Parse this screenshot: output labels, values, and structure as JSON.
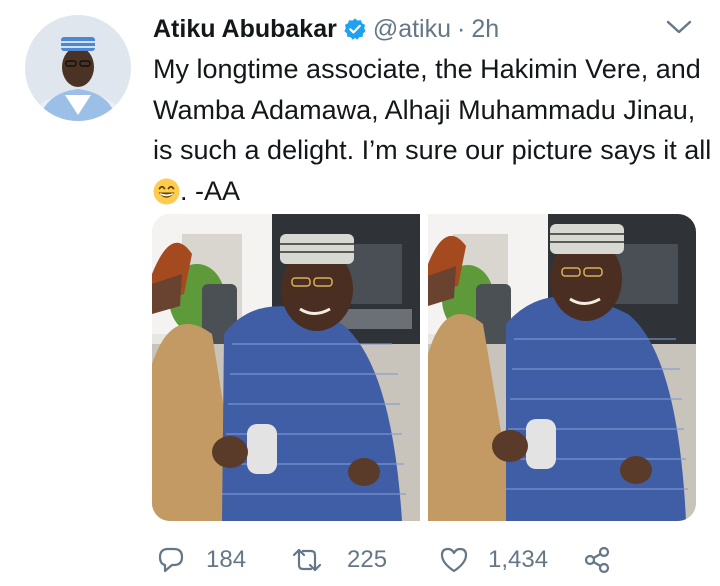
{
  "tweet": {
    "author_name": "Atiku Abubakar",
    "handle": "@atiku",
    "separator": "·",
    "time": "2h",
    "text": "My longtime associate, the Hakimin Vere, and Wamba Adamawa, Alhaji Muhammadu Jinau, is such a delight. I’m sure our picture says it all",
    "text_suffix": ". -AA",
    "emoji": "grinning-face-with-smiling-eyes"
  },
  "actions": {
    "reply_count": "184",
    "retweet_count": "225",
    "like_count": "1,434"
  },
  "icons": {
    "verified": "verified-badge-icon",
    "caret": "chevron-down-icon",
    "reply": "reply-icon",
    "retweet": "retweet-icon",
    "like": "heart-icon",
    "share": "share-icon"
  },
  "colors": {
    "text": "#14171a",
    "secondary": "#657786",
    "verified": "#1da1f2"
  }
}
